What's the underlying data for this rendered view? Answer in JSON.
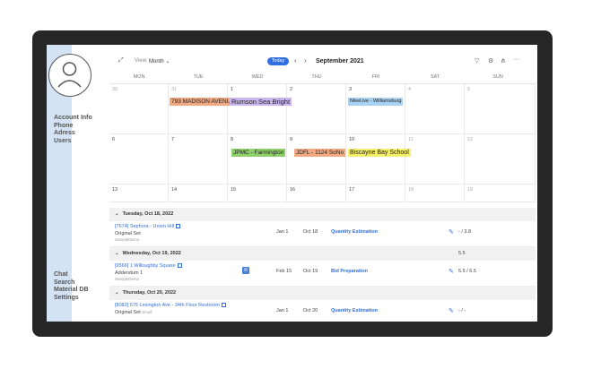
{
  "sidebar": {
    "menu_top": [
      "Account Info",
      "Phone",
      "Adress",
      "Users"
    ],
    "menu_bottom": [
      "Chat",
      "Search",
      "Material DB",
      "Settings"
    ]
  },
  "toolbar": {
    "view_label": "View:",
    "view_value": "Month",
    "today_label": "Today",
    "month_title": "September 2021",
    "prev": "‹",
    "next": "›",
    "more": "···"
  },
  "calendar": {
    "weekdays": [
      "MON",
      "TUE",
      "WED",
      "THU",
      "FRI",
      "SAT",
      "SUN"
    ],
    "weeks": [
      [
        "30",
        "31",
        "1",
        "2",
        "3",
        "4",
        "5"
      ],
      [
        "6",
        "7",
        "8",
        "9",
        "10",
        "11",
        "12"
      ],
      [
        "13",
        "14",
        "15",
        "16",
        "17",
        "18",
        "19"
      ]
    ],
    "events": [
      {
        "label": "793 MADISON AVENUE",
        "color": "#f2a982"
      },
      {
        "label": "Rumson Sea Bright",
        "color": "#c9b6ee"
      },
      {
        "label": "NikeLive - Williamsburg",
        "color": "#a9d2f2"
      },
      {
        "label": "JPMC - Farmington",
        "color": "#8fd06a"
      },
      {
        "label": "JDFL - 1124 SoNo",
        "color": "#f2a982"
      },
      {
        "label": "Biscayne Bay School",
        "color": "#f5ee6a"
      }
    ]
  },
  "list": {
    "groups": [
      {
        "title": "Tuesday, Oct 18, 2022",
        "rows": [
          {
            "title": "[7674] Sephora - Union Hill",
            "sub": "Original Set",
            "user": "SampleDemo",
            "d1": "Jan 1",
            "d2": "Oct 18",
            "task": "Quantity Estimation",
            "score": "- / 3.8"
          }
        ]
      },
      {
        "title": "Wednesday, Oct 19, 2022",
        "extra": "5.5",
        "rows": [
          {
            "title": "[9566] 1 Willoughby Square",
            "sub": "Addendum 1",
            "user": "SampleDemo",
            "badge": "R",
            "d1": "Feb 15",
            "d2": "Oct 19",
            "task": "Bid Preparation",
            "score": "5.5 / 6.5"
          }
        ]
      },
      {
        "title": "Thursday, Oct 20, 2022",
        "rows": [
          {
            "title": "[8082] 575 Lexington Ave - 34th Floor Restroom",
            "sub": "Original Set",
            "sub_small": "Small",
            "user": "",
            "d1": "Jan 1",
            "d2": "Oct 20",
            "task": "Quantity Estimation",
            "score": "- / -"
          }
        ]
      }
    ]
  }
}
